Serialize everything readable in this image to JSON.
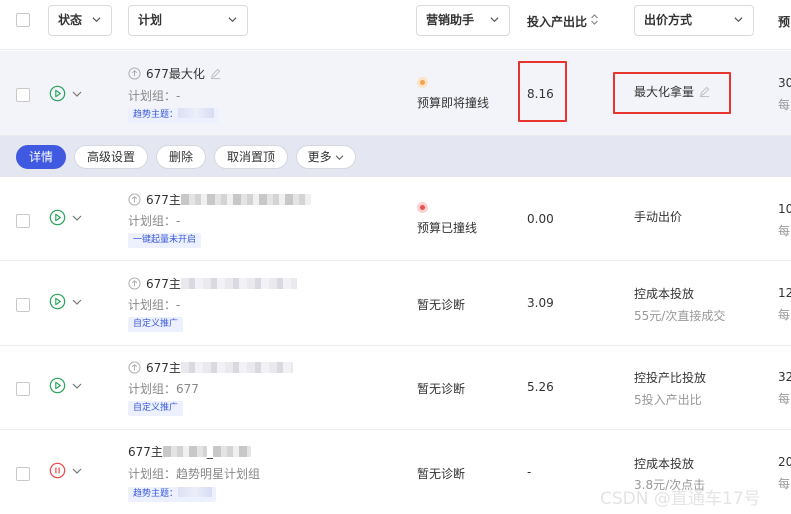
{
  "header": {
    "status": "状态",
    "plan": "计划",
    "marketing_assistant": "营销助手",
    "roi": "投入产出比",
    "bid_method": "出价方式",
    "budget_truncated": "预"
  },
  "actions": {
    "details": "详情",
    "advanced": "高级设置",
    "delete": "删除",
    "unpin": "取消置顶",
    "more": "更多"
  },
  "rows": [
    {
      "status": "active",
      "name": "677最大化",
      "group": "计划组：-",
      "tag": "趋势主题：",
      "assistant": "预算即将撞线",
      "assistant_level": "warning",
      "roi": "8.16",
      "bid": "最大化拿量",
      "bid_sub": "",
      "budget": "30",
      "budget_sub": "每"
    },
    {
      "status": "active",
      "name": "677主",
      "group": "计划组：-",
      "tag": "一键起量未开启",
      "assistant": "预算已撞线",
      "assistant_level": "danger",
      "roi": "0.00",
      "bid": "手动出价",
      "bid_sub": "",
      "budget": "10",
      "budget_sub": "每"
    },
    {
      "status": "active",
      "name": "677主",
      "group": "计划组：-",
      "tag": "自定义推广",
      "assistant": "暂无诊断",
      "assistant_level": "none",
      "roi": "3.09",
      "bid": "控成本投放",
      "bid_sub": "55元/次直接成交",
      "budget": "12",
      "budget_sub": "每"
    },
    {
      "status": "active",
      "name": "677主",
      "group": "计划组：677",
      "tag": "自定义推广",
      "assistant": "暂无诊断",
      "assistant_level": "none",
      "roi": "5.26",
      "bid": "控投产比投放",
      "bid_sub": "5投入产出比",
      "budget": "32",
      "budget_sub": "每"
    },
    {
      "status": "paused",
      "name": "677主",
      "name_suffix": "_",
      "group": "计划组：趋势明星计划组",
      "tag": "趋势主题：",
      "assistant": "暂无诊断",
      "assistant_level": "none",
      "roi": "-",
      "bid": "控成本投放",
      "bid_sub": "3.8元/次点击",
      "budget": "20",
      "budget_sub": "每"
    }
  ],
  "watermark": "CSDN @直通车17号",
  "colors": {
    "primary": "#3f5ae0",
    "play_green": "#27a55a",
    "pause_red": "#e84848",
    "highlight_box": "#e8342f",
    "tag_bg": "#edf0ff",
    "tag_text": "#3b5bdb"
  }
}
